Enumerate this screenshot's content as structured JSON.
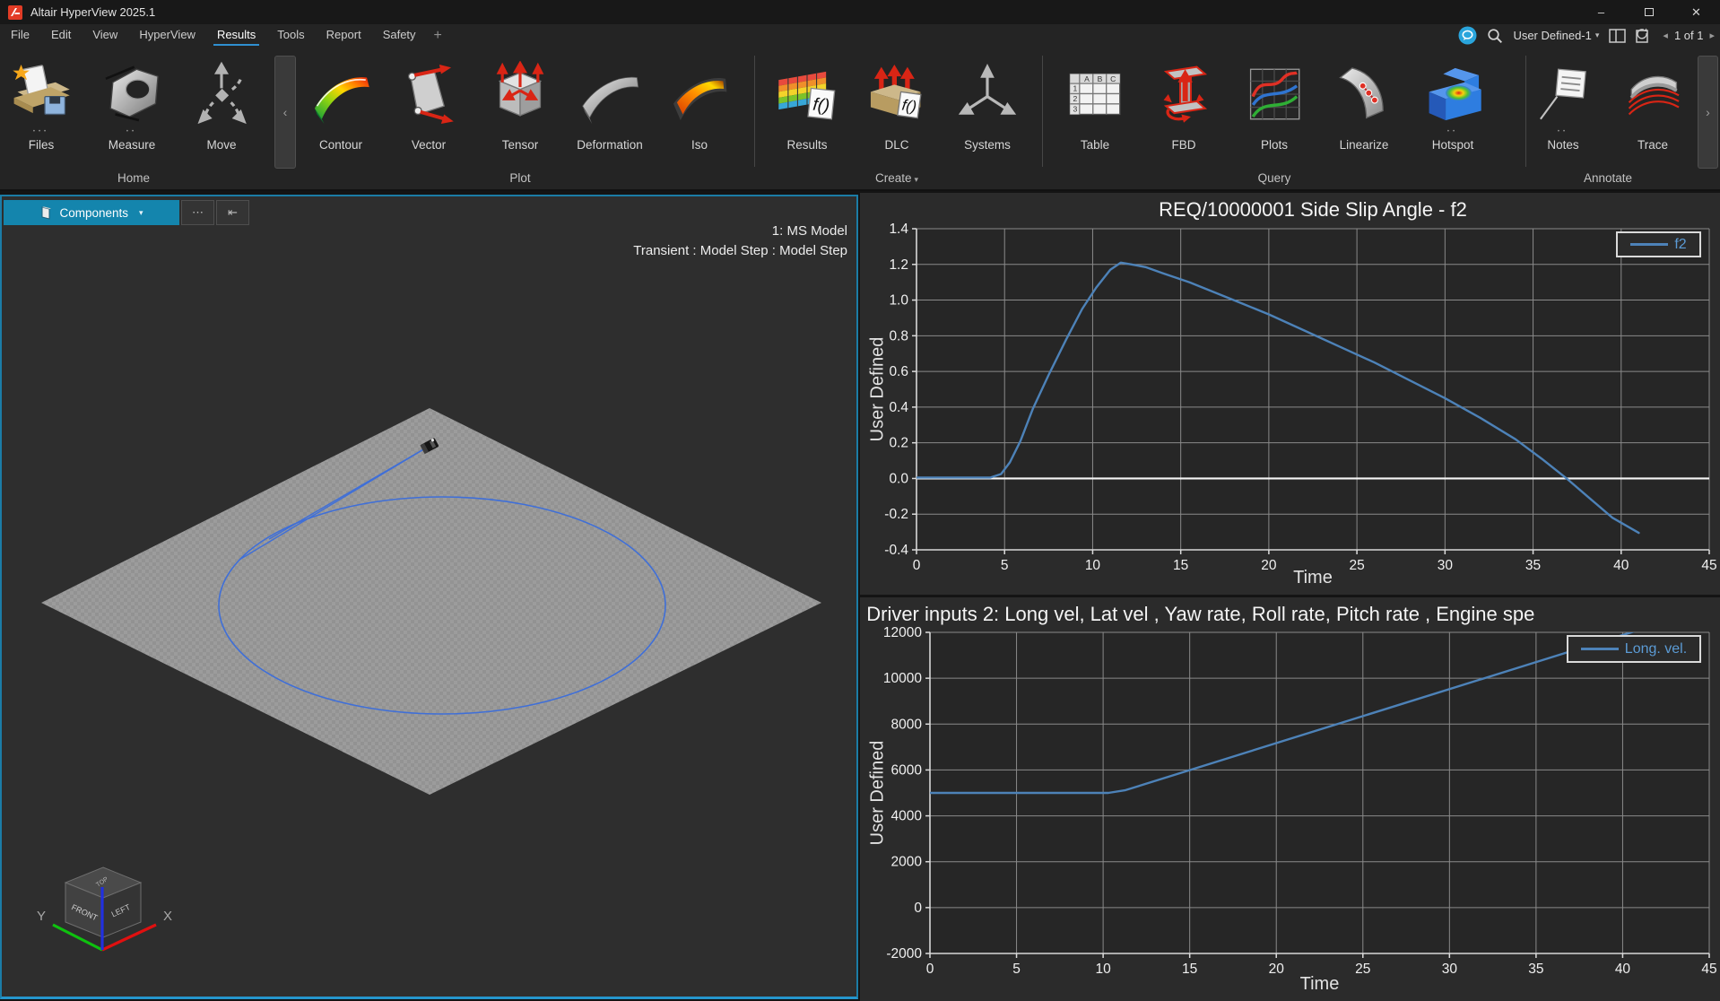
{
  "window": {
    "app_title": "Altair HyperView 2025.1",
    "controls": {
      "minimize": "–",
      "close": "✕"
    }
  },
  "menu": {
    "items": [
      {
        "label": "File"
      },
      {
        "label": "Edit"
      },
      {
        "label": "View"
      },
      {
        "label": "HyperView"
      },
      {
        "label": "Results",
        "active": true
      },
      {
        "label": "Tools"
      },
      {
        "label": "Report"
      },
      {
        "label": "Safety"
      }
    ],
    "add_label": "+",
    "right": {
      "profile": "User Defined-1",
      "caret": "▾",
      "page": "1 of 1",
      "prev": "◂",
      "next": "▸"
    }
  },
  "ribbon": {
    "groups": [
      {
        "label": "Home",
        "items": [
          {
            "label": "Files",
            "icon": "files-icon",
            "dots": "•••"
          },
          {
            "label": "Measure",
            "icon": "measure-icon",
            "dots": "••"
          },
          {
            "label": "Move",
            "icon": "move-icon",
            "dots": ""
          }
        ]
      },
      {
        "label": "Plot",
        "items": [
          {
            "label": "Contour",
            "icon": "contour-icon",
            "dots": ""
          },
          {
            "label": "Vector",
            "icon": "vector-icon",
            "dots": ""
          },
          {
            "label": "Tensor",
            "icon": "tensor-icon",
            "dots": ""
          },
          {
            "label": "Deformation",
            "icon": "deformation-icon",
            "dots": ""
          },
          {
            "label": "Iso",
            "icon": "iso-icon",
            "dots": ""
          }
        ]
      },
      {
        "label": "Create",
        "caret": "▾",
        "items": [
          {
            "label": "Results",
            "icon": "results-icon",
            "dots": ""
          },
          {
            "label": "DLC",
            "icon": "dlc-icon",
            "dots": ""
          },
          {
            "label": "Systems",
            "icon": "systems-icon",
            "dots": ""
          }
        ]
      },
      {
        "label": "Query",
        "items": [
          {
            "label": "Table",
            "icon": "table-icon",
            "dots": ""
          },
          {
            "label": "FBD",
            "icon": "fbd-icon",
            "dots": ""
          },
          {
            "label": "Plots",
            "icon": "plots-icon",
            "dots": ""
          },
          {
            "label": "Linearize",
            "icon": "linearize-icon",
            "dots": ""
          },
          {
            "label": "Hotspot",
            "icon": "hotspot-icon",
            "dots": "••"
          }
        ]
      },
      {
        "label": "Annotate",
        "items": [
          {
            "label": "Notes",
            "icon": "notes-icon",
            "dots": "••"
          },
          {
            "label": "Trace",
            "icon": "trace-icon",
            "dots": ""
          }
        ]
      }
    ],
    "collapse_glyph": "‹",
    "expand_glyph": "›"
  },
  "viewport": {
    "selector_label": "Components",
    "selector_caret": "▾",
    "more_glyph": "⋯",
    "first_glyph": "⇤",
    "model_name": "1: MS Model",
    "model_step": "Transient : Model Step : Model Step",
    "cube": {
      "front": "FRONT",
      "left": "LEFT",
      "top": "TOP",
      "x": "X",
      "y": "Y"
    }
  },
  "chart_data": [
    {
      "type": "line",
      "title": "REQ/10000001 Side Slip Angle - f2",
      "xlabel": "Time",
      "ylabel": "User Defined",
      "xlim": [
        0,
        45
      ],
      "ylim": [
        -0.4,
        1.4
      ],
      "xticks": [
        0,
        5,
        10,
        15,
        20,
        25,
        30,
        35,
        40,
        45
      ],
      "xtick_labels": [
        "0",
        "5",
        "10",
        "15",
        "20",
        "25",
        "30",
        "35",
        "40",
        "45"
      ],
      "yticks": [
        -0.4,
        -0.2,
        0.0,
        0.2,
        0.4,
        0.6,
        0.8,
        1.0,
        1.2,
        1.4
      ],
      "ytick_labels": [
        "-0.4",
        "-0.2",
        "0.0",
        "0.2",
        "0.4",
        "0.6",
        "0.8",
        "1.0",
        "1.2",
        "1.4"
      ],
      "grid": true,
      "zero_line": 0,
      "legend": "f2",
      "legend_position": "top-right",
      "series": [
        {
          "name": "f2",
          "color": "#4d82b8",
          "points": [
            [
              0,
              0.005
            ],
            [
              4.2,
              0.005
            ],
            [
              4.8,
              0.025
            ],
            [
              5.3,
              0.09
            ],
            [
              5.9,
              0.21
            ],
            [
              6.6,
              0.39
            ],
            [
              7.5,
              0.58
            ],
            [
              8.5,
              0.78
            ],
            [
              9.4,
              0.95
            ],
            [
              10.2,
              1.07
            ],
            [
              11,
              1.17
            ],
            [
              11.6,
              1.21
            ],
            [
              12.2,
              1.2
            ],
            [
              13,
              1.185
            ],
            [
              14,
              1.15
            ],
            [
              15.5,
              1.1
            ],
            [
              17,
              1.04
            ],
            [
              18.5,
              0.98
            ],
            [
              20,
              0.92
            ],
            [
              22,
              0.83
            ],
            [
              24,
              0.74
            ],
            [
              26,
              0.65
            ],
            [
              28,
              0.55
            ],
            [
              30,
              0.45
            ],
            [
              32,
              0.34
            ],
            [
              34,
              0.22
            ],
            [
              35.5,
              0.11
            ],
            [
              36.9,
              0
            ],
            [
              38.2,
              -0.11
            ],
            [
              39.5,
              -0.22
            ],
            [
              41,
              -0.305
            ]
          ]
        }
      ]
    },
    {
      "type": "line",
      "title": ": Driver inputs 2:  Long vel, Lat vel , Yaw rate, Roll rate, Pitch rate , Engine spe",
      "xlabel": "Time",
      "ylabel": "User Defined",
      "xlim": [
        0,
        45
      ],
      "ylim": [
        -2000,
        12000
      ],
      "xticks": [
        0,
        5,
        10,
        15,
        20,
        25,
        30,
        35,
        40,
        45
      ],
      "xtick_labels": [
        "0",
        "5",
        "10",
        "15",
        "20",
        "25",
        "30",
        "35",
        "40",
        "45"
      ],
      "yticks": [
        -2000,
        0,
        2000,
        4000,
        6000,
        8000,
        10000,
        12000
      ],
      "ytick_labels": [
        "-2000",
        "0",
        "2000",
        "4000",
        "6000",
        "8000",
        "10000",
        "12000"
      ],
      "grid": true,
      "legend": "Long. vel.",
      "legend_position": "top-right",
      "series": [
        {
          "name": "Long. vel.",
          "color": "#4d82b8",
          "points": [
            [
              0,
              5000
            ],
            [
              10.3,
              5000
            ],
            [
              11.3,
              5120
            ],
            [
              41.6,
              12260
            ]
          ]
        }
      ]
    }
  ]
}
